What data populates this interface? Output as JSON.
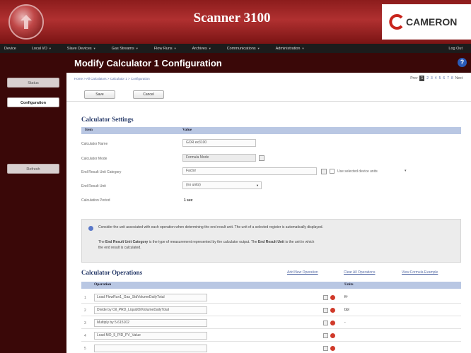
{
  "header": {
    "app_title": "Scanner 3100",
    "brand": "CAMERON"
  },
  "nav": {
    "items": [
      {
        "label": "Device",
        "has_menu": true
      },
      {
        "label": "Local I/O",
        "has_menu": true
      },
      {
        "label": "Slave Devices",
        "has_menu": true
      },
      {
        "label": "Gas Streams",
        "has_menu": true
      },
      {
        "label": "Flow Runs",
        "has_menu": true
      },
      {
        "label": "Archives",
        "has_menu": true
      },
      {
        "label": "Communications",
        "has_menu": true
      },
      {
        "label": "Administration",
        "has_menu": true
      }
    ],
    "logout": "Log Out"
  },
  "sidebar": {
    "status": "Status",
    "configuration": "Configuration",
    "refresh": "Refresh"
  },
  "page": {
    "title": "Modify Calculator 1 Configuration",
    "help_icon": "?",
    "breadcrumb": "Home > All Calculators > Calculator 1 > Configuration",
    "pager": {
      "prev": "Prev",
      "pages": [
        "1",
        "2",
        "3",
        "4",
        "5",
        "6",
        "7",
        "8"
      ],
      "current": "1",
      "next": "Next"
    },
    "save": "Save",
    "cancel": "Cancel"
  },
  "settings": {
    "title": "Calculator Settings",
    "col_item": "Item",
    "col_value": "Value",
    "calculator_name_label": "Calculator Name",
    "calculator_name_value": "GOR ex3100",
    "calculator_mode_label": "Calculator Mode",
    "calculator_mode_value": "Formula Mode",
    "unit_category_label": "End Result Unit Category",
    "unit_category_value": "Factor",
    "use_device_units": "Use selected device units",
    "end_unit_label": "End Result Unit",
    "end_unit_value": "(no units)",
    "period_label": "Calculation Period",
    "period_value": "1 sec"
  },
  "info": {
    "line1": "Consider the unit associated with each operation when determining the end result unit. The unit of a selected register is automatically displayed.",
    "line2_prefix": "The",
    "line2_bold1": "End Result Unit Category",
    "line2_mid": "is the type of measurement represented by the calculator output. The",
    "line2_bold2": "End Result Unit",
    "line2_suffix": "is the unit in which",
    "line3": "the end result is calculated."
  },
  "operations": {
    "title": "Calculator Operations",
    "add_link": "Add New Operation",
    "clear_link": "Clear All Operations",
    "example_link": "View Formula Example",
    "col_operation": "Operation",
    "col_units": "Units",
    "rows": [
      {
        "num": "1",
        "op": "Load FlowRun1_Gas_StdVolumeDailyTotal",
        "units": "ft³"
      },
      {
        "num": "2",
        "op": "Divide by Oil_PRD_LiquidOilVolumeDailyTotal",
        "units": "bbl"
      },
      {
        "num": "3",
        "op": "Multiply by 5.615102",
        "units": "-"
      },
      {
        "num": "4",
        "op": "Load MO_5_PID_PV_Value",
        "units": ""
      },
      {
        "num": "5",
        "op": "",
        "units": ""
      }
    ]
  },
  "colors": {
    "header_red": "#b03030",
    "sidebar_maroon": "#3a0808",
    "table_header_blue": "#b9c7e3",
    "link_blue": "#5a6fa8",
    "delete_red": "#d03a2a"
  }
}
